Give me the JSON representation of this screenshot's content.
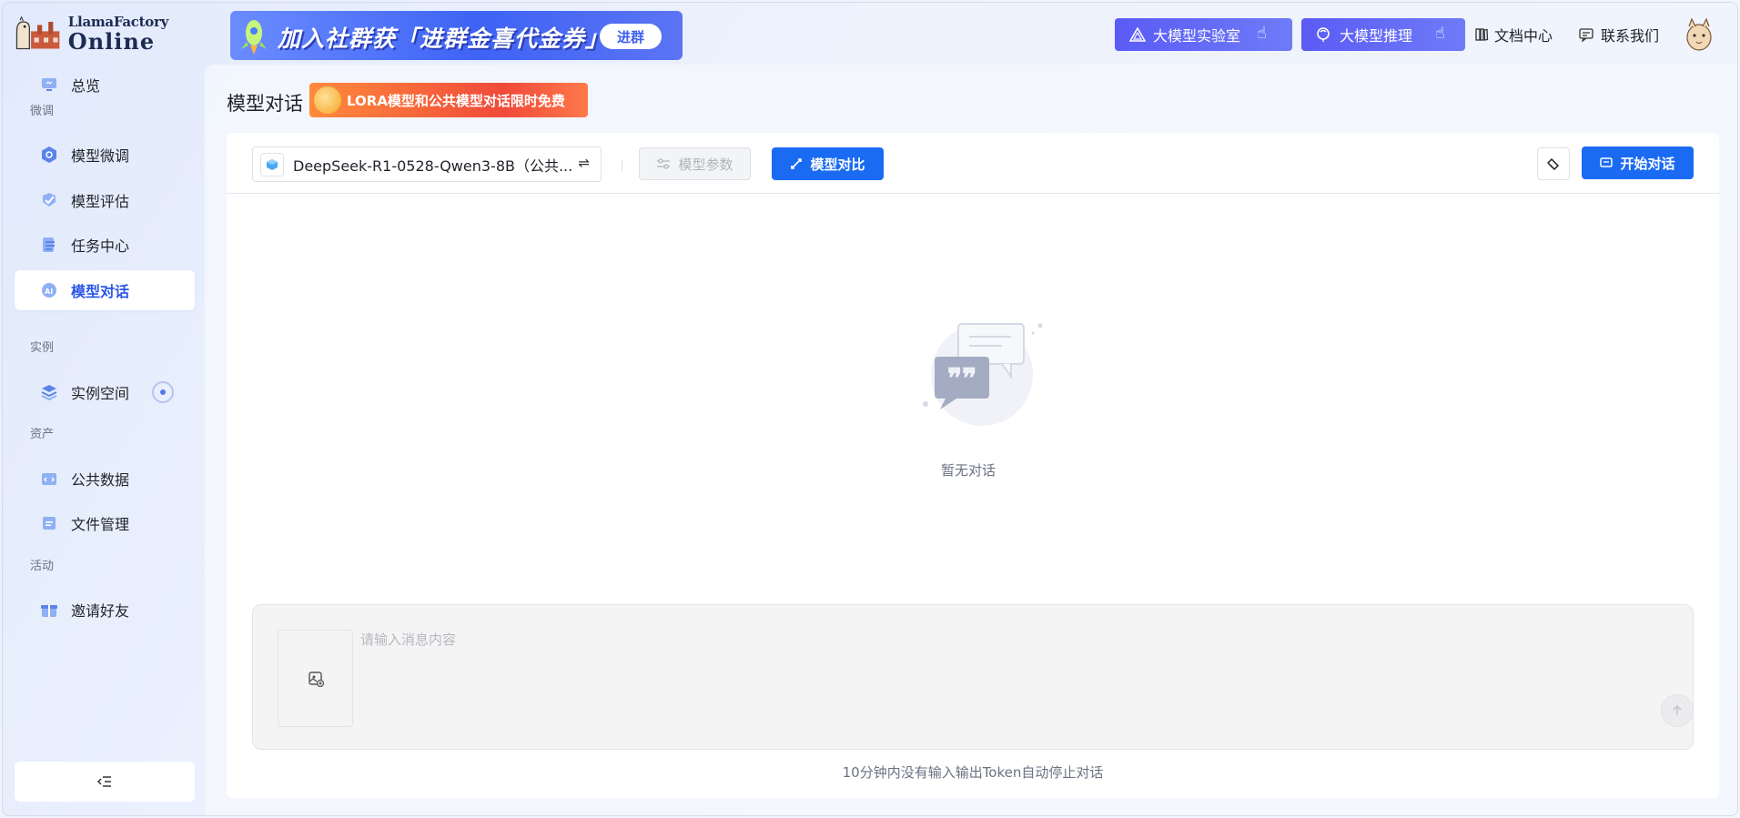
{
  "header": {
    "logo_line1": "LlamaFactory",
    "logo_line2": "Online",
    "banner_text": "加入社群获「进群金喜代金券」",
    "banner_button": "进群",
    "lab_button": "大模型实验室",
    "inference_button": "大模型推理",
    "docs_link": "文档中心",
    "contact_link": "联系我们"
  },
  "sidebar": {
    "overview": "总览",
    "group_finetune": "微调",
    "finetune": "模型微调",
    "evaluate": "模型评估",
    "tasks": "任务中心",
    "chat": "模型对话",
    "group_instance": "实例",
    "instances": "实例空间",
    "group_assets": "资产",
    "public_data": "公共数据",
    "files": "文件管理",
    "group_activity": "活动",
    "invite": "邀请好友",
    "collapse_icon": "collapse-menu-icon"
  },
  "main": {
    "title": "模型对话",
    "promo_text": "LORA模型和公共模型对话限时免费",
    "model_name": "DeepSeek-R1-0528-Qwen3-8B（公共...",
    "params_button": "模型参数",
    "compare_button": "模型对比",
    "start_button": "开始对话",
    "empty_text": "暂无对话",
    "input_placeholder": "请输入消息内容",
    "footnote": "10分钟内没有输入输出Token自动停止对话"
  },
  "colors": {
    "primary": "#1a6bf2",
    "header_button": "#5b5bf5",
    "active_text": "#2a56e6"
  }
}
